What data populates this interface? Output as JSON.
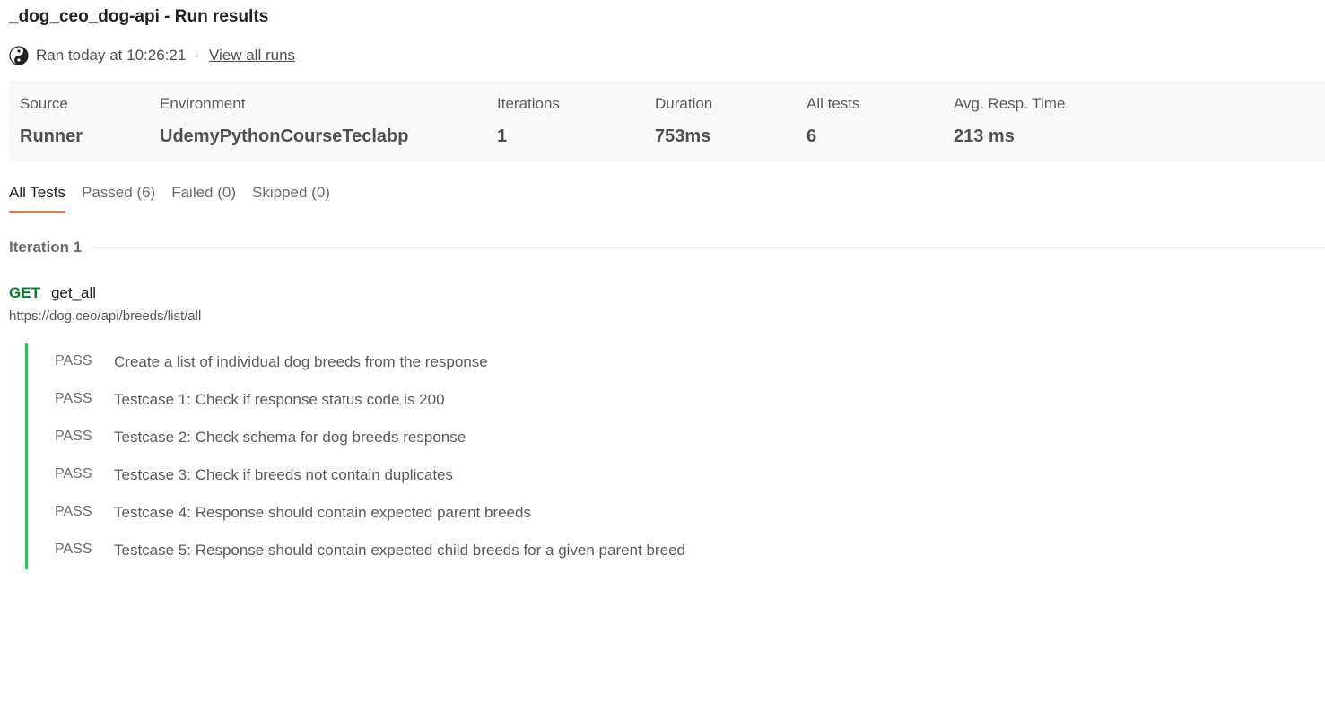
{
  "header": {
    "title": "_dog_ceo_dog-api - Run results",
    "ran_text": "Ran today at 10:26:21",
    "separator": "·",
    "view_all_label": "View all runs"
  },
  "summary": {
    "stats": [
      {
        "label": "Source",
        "value": "Runner"
      },
      {
        "label": "Environment",
        "value": "UdemyPythonCourseTeclabp"
      },
      {
        "label": "Iterations",
        "value": "1"
      },
      {
        "label": "Duration",
        "value": "753ms"
      },
      {
        "label": "All tests",
        "value": "6"
      },
      {
        "label": "Avg. Resp. Time",
        "value": "213 ms"
      }
    ]
  },
  "tabs": [
    {
      "label": "All Tests",
      "active": true
    },
    {
      "label": "Passed (6)",
      "active": false
    },
    {
      "label": "Failed (0)",
      "active": false
    },
    {
      "label": "Skipped (0)",
      "active": false
    }
  ],
  "iteration": {
    "label": "Iteration 1"
  },
  "request": {
    "method": "GET",
    "name": "get_all",
    "url": "https://dog.ceo/api/breeds/list/all"
  },
  "results": [
    {
      "status": "PASS",
      "name": "Create a list of individual dog breeds from the response"
    },
    {
      "status": "PASS",
      "name": "Testcase 1: Check if response status code is 200"
    },
    {
      "status": "PASS",
      "name": "Testcase 2: Check schema for dog breeds response"
    },
    {
      "status": "PASS",
      "name": "Testcase 3: Check if breeds not contain duplicates"
    },
    {
      "status": "PASS",
      "name": "Testcase 4: Response should contain expected parent breeds"
    },
    {
      "status": "PASS",
      "name": "Testcase 5: Response should contain expected child breeds for a given parent breed"
    }
  ],
  "colors": {
    "method_get": "#0a7d26",
    "pass_bar": "#2fbe5a",
    "active_tab_underline": "#ff6c37",
    "summary_bg": "#f9f9f9"
  },
  "icons": {
    "avatar": "user-avatar-icon"
  }
}
